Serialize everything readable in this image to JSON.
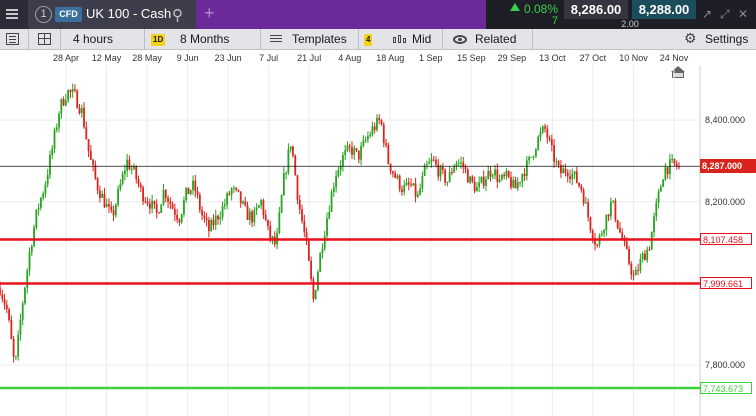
{
  "header": {
    "tab_number": "1",
    "cfd_tag": "CFD",
    "instrument": "UK 100 - Cash",
    "change_pct": "0.08%",
    "change_pts": "7",
    "sell_price": "8,286.00",
    "buy_price": "8,288.00",
    "spread": "2.00",
    "colors": {
      "purple": "#6b2a98",
      "positive": "#3ad04a",
      "buy_bg": "#1b4d5c"
    }
  },
  "toolbar": {
    "timeframe": "4 hours",
    "period_badge": "1D",
    "period": "8 Months",
    "templates": "Templates",
    "indicator_count": "4",
    "price_mode": "Mid",
    "related": "Related",
    "settings": "Settings"
  },
  "chart_data": {
    "type": "candlestick",
    "title": "",
    "x_ticks": [
      "28 Apr",
      "12 May",
      "28 May",
      "9 Jun",
      "23 Jun",
      "7 Jul",
      "21 Jul",
      "4 Aug",
      "18 Aug",
      "1 Sep",
      "15 Sep",
      "29 Sep",
      "13 Oct",
      "27 Oct",
      "10 Nov",
      "24 Nov"
    ],
    "y_ticks": [
      8400,
      8200,
      7800
    ],
    "y_tick_labels": [
      "8,400.000",
      "8,200.000",
      "7,800.000"
    ],
    "ylim": [
      7675,
      8535
    ],
    "current_price": 8287.0,
    "current_price_label": "8,287.000",
    "horizontal_levels": [
      {
        "value": 8107.458,
        "label": "8,107.458",
        "color": "#e8111c"
      },
      {
        "value": 7999.661,
        "label": "7,999.661",
        "color": "#e8111c"
      },
      {
        "value": 7743.673,
        "label": "7,743.673",
        "color": "#3cd23c"
      }
    ],
    "up_color": "#26a31f",
    "down_color": "#d9241e",
    "closes": [
      7990,
      7930,
      7790,
      7950,
      8080,
      8180,
      8240,
      8330,
      8430,
      8470,
      8460,
      8420,
      8310,
      8240,
      8200,
      8160,
      8230,
      8300,
      8270,
      8220,
      8200,
      8170,
      8230,
      8190,
      8160,
      8220,
      8240,
      8170,
      8130,
      8160,
      8190,
      8230,
      8210,
      8170,
      8160,
      8200,
      8120,
      8090,
      8250,
      8350,
      8200,
      8100,
      7960,
      8080,
      8180,
      8270,
      8310,
      8330,
      8310,
      8350,
      8380,
      8400,
      8300,
      8260,
      8230,
      8240,
      8210,
      8280,
      8300,
      8270,
      8250,
      8300,
      8290,
      8250,
      8230,
      8260,
      8280,
      8250,
      8260,
      8230,
      8270,
      8300,
      8350,
      8380,
      8320,
      8270,
      8280,
      8260,
      8230,
      8150,
      8090,
      8150,
      8200,
      8130,
      8070,
      8010,
      8060,
      8090,
      8190,
      8280,
      8290,
      8287
    ],
    "x_start": 0,
    "x_end": 679
  }
}
